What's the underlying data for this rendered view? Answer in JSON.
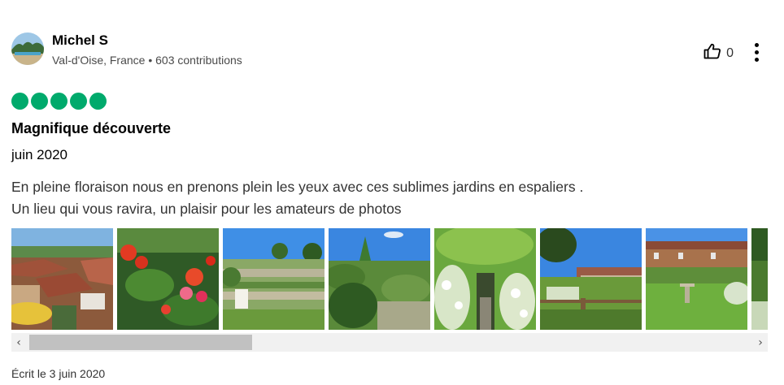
{
  "review": {
    "author": {
      "name": "Michel S",
      "meta": "Val-d'Oise, France • 603 contributions",
      "avatar_icon": "avatar-landscape"
    },
    "helpful": {
      "icon": "thumbs-up-icon",
      "count": "0"
    },
    "more_icon": "more-vertical-icon",
    "rating": {
      "value": 5,
      "max": 5,
      "color": "#00aa6c"
    },
    "title": "Magnifique découverte",
    "visit_date": "juin 2020",
    "text_lines": [
      "En pleine floraison nous en prenons plein les yeux avec ces sublimes jardins en espaliers .",
      "Un lieu qui vous ravira, un plaisir pour les amateurs de photos"
    ],
    "photos": [
      {
        "subject": "village-rooftops"
      },
      {
        "subject": "red-roses"
      },
      {
        "subject": "terraced-garden"
      },
      {
        "subject": "garden-trees"
      },
      {
        "subject": "white-rose-arch"
      },
      {
        "subject": "garden-houses"
      },
      {
        "subject": "lawn-birdbath"
      },
      {
        "subject": "partial-photo"
      }
    ],
    "scrollbar": {
      "left_icon": "chevron-left",
      "right_icon": "chevron-right",
      "left_glyph": "‹",
      "right_glyph": "›",
      "position": 0
    },
    "written_date": "Écrit le 3 juin 2020"
  }
}
